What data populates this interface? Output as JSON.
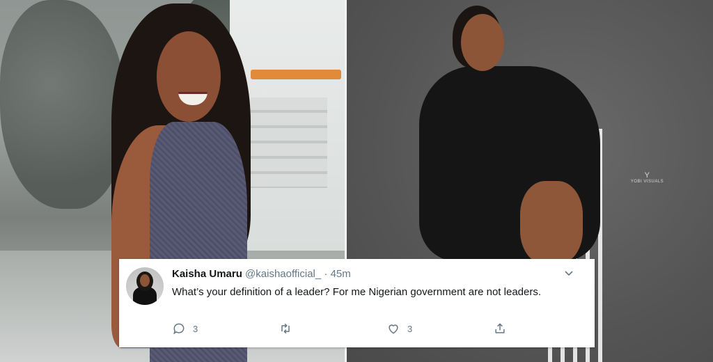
{
  "watermark": {
    "logo": "Y",
    "text": "YOBI VISUALS"
  },
  "tweet": {
    "name": "Kaisha Umaru",
    "handle": "@kaishaofficial_",
    "separator": "·",
    "time": "45m",
    "text": "What’s your definition of a leader?  For me Nigerian government are not leaders.",
    "reply_count": "3",
    "like_count": "3",
    "icons": [
      "reply-icon",
      "retweet-icon",
      "like-icon",
      "share-icon",
      "chevron-down-icon"
    ]
  }
}
